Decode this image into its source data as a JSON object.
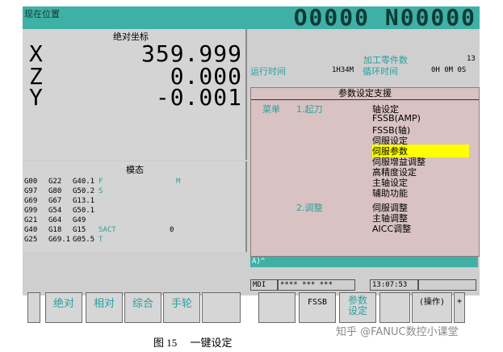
{
  "header": {
    "location_label": "现在位置",
    "program": "O0000 N00000"
  },
  "coords": {
    "title": "绝对坐标",
    "axes": [
      {
        "name": "X",
        "value": "359.999"
      },
      {
        "name": "Z",
        "value": "0.000"
      },
      {
        "name": "Y",
        "value": "-0.001"
      }
    ]
  },
  "info": {
    "parts_label": "加工零件数",
    "parts_value": "13",
    "runtime_label": "运行时间",
    "runtime_value": "1H34M",
    "cycle_label": "循环时间",
    "cycle_value": "0H 0M 0S"
  },
  "dialog": {
    "title": "参数设定支援",
    "menu_label": "菜单",
    "section1": "1.起刀",
    "section2": "2.调整",
    "items1": [
      "轴设定",
      "FSSB(AMP)",
      "FSSB(轴)",
      "伺服设定",
      "伺服参数",
      "伺服增益调整",
      "高精度设定",
      "主轴设定",
      "辅助功能"
    ],
    "items2": [
      "伺服调整",
      "主轴调整",
      "AICC调整"
    ],
    "selected": "伺服参数"
  },
  "modal": {
    "title": "模态",
    "rows": [
      [
        "G00",
        "G22",
        "G40.1",
        "F",
        "",
        "M"
      ],
      [
        "G97",
        "G80",
        "G50.2",
        "S",
        "",
        ""
      ],
      [
        "G69",
        "G67",
        "G13.1",
        "",
        "",
        ""
      ],
      [
        "G99",
        "G54",
        "G50.1",
        "",
        "",
        ""
      ],
      [
        "G21",
        "G64",
        "G49",
        "",
        "",
        ""
      ],
      [
        "G40",
        "G18",
        "G15",
        "SACT",
        "0",
        ""
      ],
      [
        "G25",
        "G69.1",
        "G05.5",
        "T",
        "",
        ""
      ]
    ]
  },
  "cmdline": "A)^",
  "status": {
    "mode": "MDI",
    "stars": "**** *** ***",
    "time": "13:07:53"
  },
  "softkeys": [
    "绝对",
    "相对",
    "综合",
    "手轮",
    "",
    "",
    "FSSB",
    "参数\n设定",
    "",
    "(操作)",
    "+"
  ],
  "caption": "图 15     一键设定",
  "watermark": "知乎 @FANUC数控小课堂"
}
